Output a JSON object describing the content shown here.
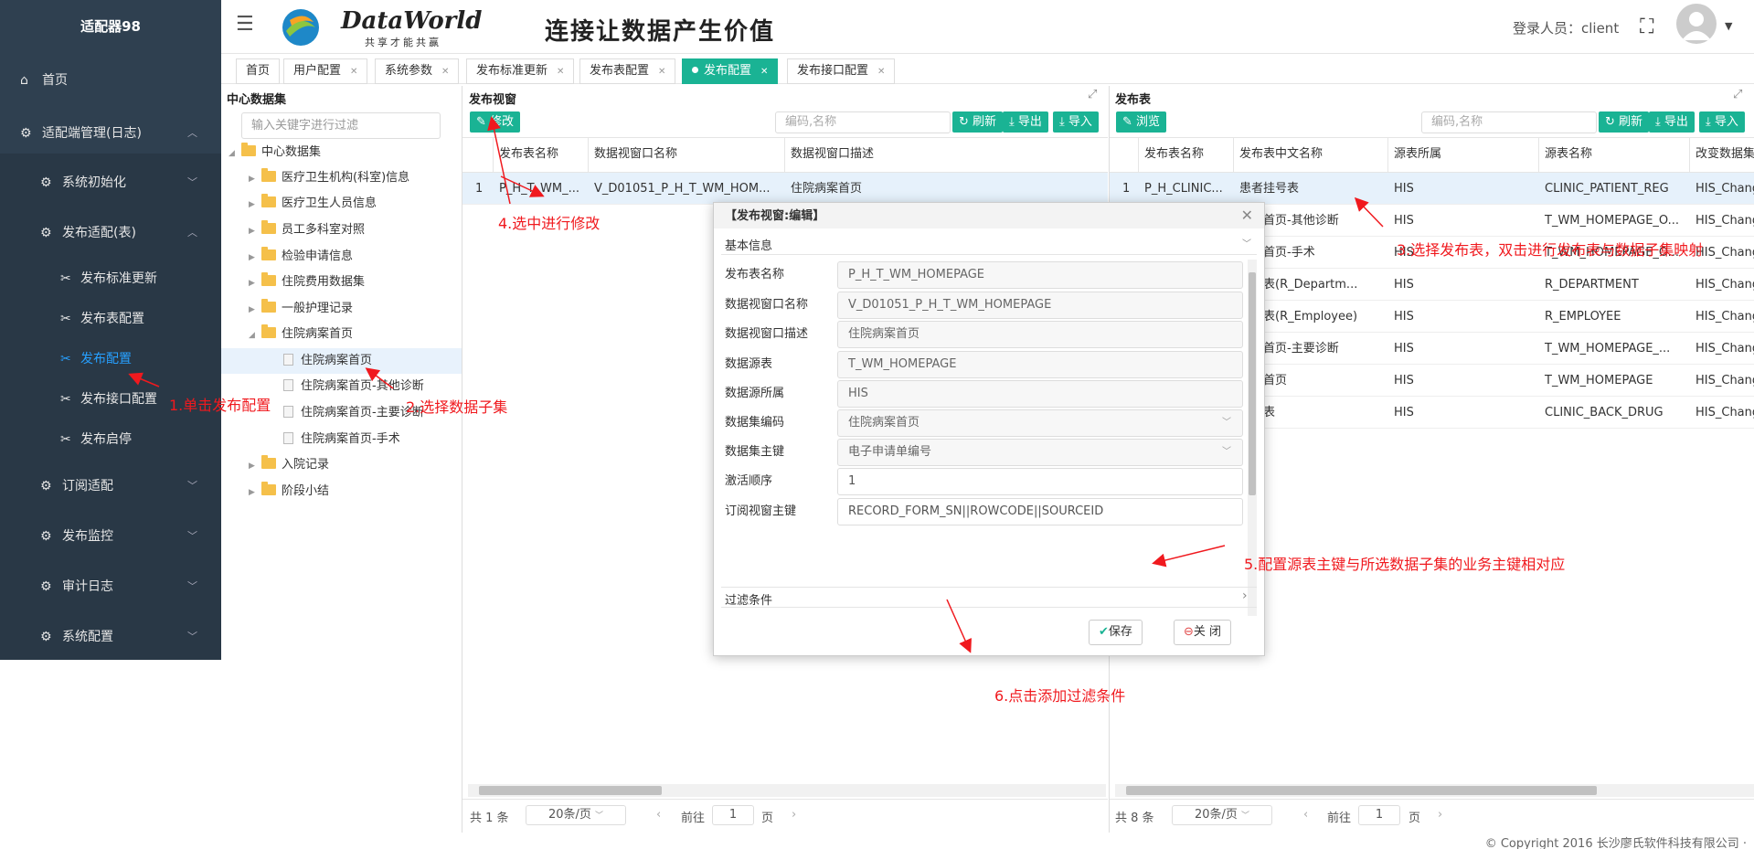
{
  "sidebar": {
    "title": "适配器98",
    "home": "首页",
    "groups": [
      {
        "label": "适配端管理(日志)"
      },
      {
        "label": "系统初始化"
      },
      {
        "label": "发布适配(表)"
      },
      {
        "label": "订阅适配"
      },
      {
        "label": "发布监控"
      },
      {
        "label": "审计日志"
      },
      {
        "label": "系统配置"
      }
    ],
    "leaves": [
      "发布标准更新",
      "发布表配置",
      "发布配置",
      "发布接口配置",
      "发布启停"
    ],
    "active_leaf": "发布配置"
  },
  "header": {
    "logo_title": "DataWorld",
    "logo_sub": "共享才能共赢",
    "slogan": "连接让数据产生价值",
    "login_label": "登录人员：client"
  },
  "tabs": [
    "首页",
    "用户配置",
    "系统参数",
    "发布标准更新",
    "发布表配置",
    "发布配置",
    "发布接口配置"
  ],
  "active_tab": "发布配置",
  "tree": {
    "title": "中心数据集",
    "filter_placeholder": "输入关键字进行过滤",
    "root": "中心数据集",
    "nodes": [
      "医疗卫生机构(科室)信息",
      "医疗卫生人员信息",
      "员工多科室对照",
      "检验申请信息",
      "住院费用数据集",
      "一般护理记录",
      "住院病案首页"
    ],
    "children": [
      "住院病案首页",
      "住院病案首页-其他诊断",
      "住院病案首页-主要诊断",
      "住院病案首页-手术"
    ],
    "after": [
      "入院记录",
      "阶段小结"
    ]
  },
  "view_panel": {
    "title": "发布视窗",
    "edit_btn": "修改",
    "search_placeholder": "编码,名称",
    "refresh": "刷新",
    "export": "导出",
    "import": "导入",
    "columns": [
      "发布表名称",
      "数据视窗口名称",
      "数据视窗口描述"
    ],
    "rows": [
      {
        "no": "1",
        "c1": "P_H_T_WM_...",
        "c2": "V_D01051_P_H_T_WM_HOM...",
        "c3": "住院病案首页"
      }
    ],
    "total": "共 1 条",
    "page_size": "20条/页",
    "goto": "前往",
    "page": "1",
    "page_unit": "页"
  },
  "table_panel": {
    "title": "发布表",
    "browse_btn": "浏览",
    "search_placeholder": "编码,名称",
    "refresh": "刷新",
    "export": "导出",
    "import": "导入",
    "columns": [
      "发布表名称",
      "发布表中文名称",
      "源表所属",
      "源表名称",
      "改变数据集"
    ],
    "rows": [
      {
        "no": "1",
        "c1": "P_H_CLINIC...",
        "c2": "患者挂号表",
        "c3": "HIS",
        "c4": "CLINIC_PATIENT_REG",
        "c5": "HIS_Chang"
      },
      {
        "no": "",
        "c1": "",
        "c2": "病案首页-其他诊断",
        "c3": "HIS",
        "c4": "T_WM_HOMEPAGE_O...",
        "c5": "HIS_Chang"
      },
      {
        "no": "",
        "c1": "",
        "c2": "病案首页-手术",
        "c3": "HIS",
        "c4": "T_WM_HOMEPAGE_O...",
        "c5": "HIS_Chang"
      },
      {
        "no": "",
        "c1": "",
        "c2": "代码表(R_Departm...",
        "c3": "HIS",
        "c4": "R_DEPARTMENT",
        "c5": "HIS_Chang"
      },
      {
        "no": "",
        "c1": "",
        "c2": "代码表(R_Employee)",
        "c3": "HIS",
        "c4": "R_EMPLOYEE",
        "c5": "HIS_Chang"
      },
      {
        "no": "",
        "c1": "",
        "c2": "病案首页-主要诊断",
        "c3": "HIS",
        "c4": "T_WM_HOMEPAGE_...",
        "c5": "HIS_Chang"
      },
      {
        "no": "",
        "c1": "",
        "c2": "病案首页",
        "c3": "HIS",
        "c4": "T_WM_HOMEPAGE",
        "c5": "HIS_Chang"
      },
      {
        "no": "",
        "c1": "",
        "c2": "退药表",
        "c3": "HIS",
        "c4": "CLINIC_BACK_DRUG",
        "c5": "HIS_Chang"
      }
    ],
    "total": "共 8 条",
    "page_size": "20条/页",
    "goto": "前往",
    "page": "1",
    "page_unit": "页"
  },
  "dialog": {
    "title": "【发布视窗:编辑】",
    "section_basic": "基本信息",
    "fields": [
      {
        "label": "发布表名称",
        "value": "P_H_T_WM_HOMEPAGE"
      },
      {
        "label": "数据视窗口名称",
        "value": "V_D01051_P_H_T_WM_HOMEPAGE"
      },
      {
        "label": "数据视窗口描述",
        "value": "住院病案首页"
      },
      {
        "label": "数据源表",
        "value": "T_WM_HOMEPAGE"
      },
      {
        "label": "数据源所属",
        "value": "HIS"
      },
      {
        "label": "数据集编码",
        "value": "住院病案首页"
      },
      {
        "label": "数据集主键",
        "value": "电子申请单编号"
      },
      {
        "label": "激活顺序",
        "value": "1"
      },
      {
        "label": "订阅视窗主键",
        "value": "RECORD_FORM_SN||ROWCODE||SOURCEID"
      }
    ],
    "section_filter": "过滤条件",
    "save": "保存",
    "close": "关 闭"
  },
  "annotations": {
    "a1": "1.单击发布配置",
    "a2": "2.选择数据子集",
    "a3": "3.选择发布表，双击进行发布表与数据子集映射",
    "a4": "4.选中进行修改",
    "a5": "5.配置源表主键与所选数据子集的业务主键相对应",
    "a6": "6.点击添加过滤条件"
  },
  "copyright": "© Copyright 2016 长沙廖氏软件科技有限公司 ·"
}
